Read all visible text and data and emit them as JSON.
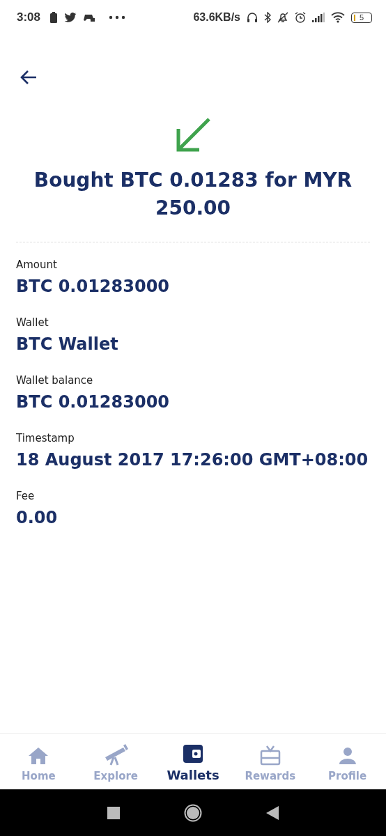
{
  "status_bar": {
    "time": "3:08",
    "speed": "63.6KB/s",
    "battery": "5"
  },
  "title": "Bought BTC 0.01283 for MYR 250.00",
  "details": [
    {
      "label": "Amount",
      "value": "BTC 0.01283000"
    },
    {
      "label": "Wallet",
      "value": "BTC Wallet"
    },
    {
      "label": "Wallet balance",
      "value": "BTC 0.01283000"
    },
    {
      "label": "Timestamp",
      "value": "18 August 2017 17:26:00 GMT+08:00"
    },
    {
      "label": "Fee",
      "value": "0.00"
    }
  ],
  "nav": [
    {
      "label": "Home",
      "selected": false
    },
    {
      "label": "Explore",
      "selected": false
    },
    {
      "label": "Wallets",
      "selected": true
    },
    {
      "label": "Rewards",
      "selected": false
    },
    {
      "label": "Profile",
      "selected": false
    }
  ]
}
